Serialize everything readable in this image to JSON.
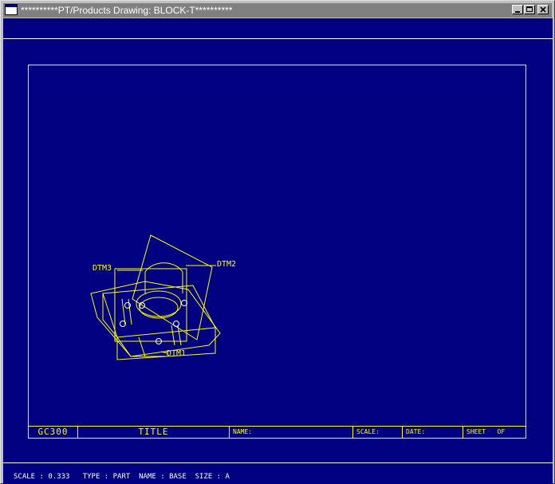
{
  "window": {
    "title": "**********PT/Products Drawing: BLOCK-T**********"
  },
  "drawing": {
    "datum_labels": {
      "dtm1": "DTM1",
      "dtm2": "DTM2",
      "dtm3": "DTM3"
    }
  },
  "title_block": {
    "drawing_number": "GC300",
    "title": "TITLE",
    "name_label": "NAME:",
    "scale_label": "SCALE:",
    "date_label": "DATE:",
    "sheet_label": "SHEET",
    "of_label": "OF"
  },
  "status_bar": {
    "text": "SCALE : 0.333   TYPE : PART  NAME : BASE  SIZE : A"
  },
  "colors": {
    "background": "#000080",
    "geometry": "#ffff00",
    "model_edges": "#ffffff"
  },
  "icons": {
    "system_menu": "window-menu-icon",
    "minimize": "minimize-icon",
    "maximize": "maximize-icon",
    "close": "close-icon"
  }
}
